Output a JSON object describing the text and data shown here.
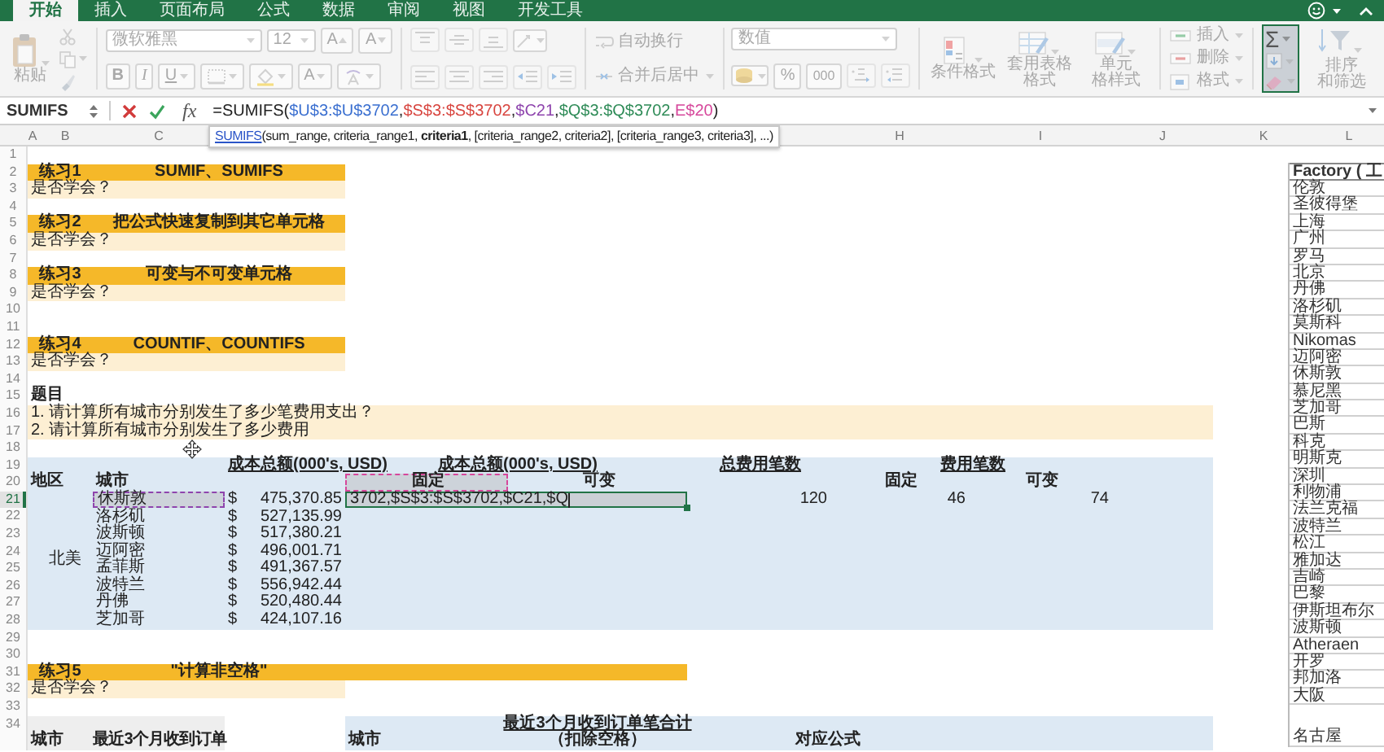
{
  "tabs": [
    {
      "label": "开始",
      "selected": true
    },
    {
      "label": "插入",
      "selected": false
    },
    {
      "label": "页面布局",
      "selected": false
    },
    {
      "label": "公式",
      "selected": false
    },
    {
      "label": "数据",
      "selected": false
    },
    {
      "label": "审阅",
      "selected": false
    },
    {
      "label": "视图",
      "selected": false
    },
    {
      "label": "开发工具",
      "selected": false
    }
  ],
  "ribbon": {
    "disabled": true,
    "paste_label": "粘贴",
    "font_name": "微软雅黑",
    "font_size": "12",
    "grow_label": "A",
    "shrink_label": "A",
    "bold_label": "B",
    "italic_label": "I",
    "underline_label": "U",
    "font_color_label": "A",
    "wrap_label": "自动换行",
    "merge_label": "合并后居中",
    "number_format": "数值",
    "percent_label": "%",
    "thousands_label": "000",
    "style_buttons": [
      {
        "kind": "conditional",
        "lines": [
          "条件格式"
        ]
      },
      {
        "kind": "table",
        "lines": [
          "套用表格",
          "格式"
        ]
      },
      {
        "kind": "cell",
        "lines": [
          "单元",
          "格样式"
        ]
      }
    ],
    "cell_buttons": [
      {
        "kind": "insert",
        "label": "插入"
      },
      {
        "kind": "delete",
        "label": "删除"
      },
      {
        "kind": "format",
        "label": "格式"
      }
    ],
    "sum_label": "Σ",
    "sort_lines": [
      "排序",
      "和筛选"
    ]
  },
  "formula_bar": {
    "name_box": "SUMIFS",
    "fx": "fx",
    "segments": [
      {
        "text": "=SUMIFS("
      },
      {
        "text": "$U$3:$U$3702",
        "color": "#3a6fd0"
      },
      {
        "text": ","
      },
      {
        "text": "$S$3:$S$3702",
        "color": "#d8453f"
      },
      {
        "text": ","
      },
      {
        "text": "$C21",
        "color": "#8e44ad"
      },
      {
        "text": ","
      },
      {
        "text": "$Q$3:$Q$3702",
        "color": "#2e8b57"
      },
      {
        "text": ","
      },
      {
        "text": "E$20",
        "color": "#d6479b"
      },
      {
        "text": ")"
      }
    ]
  },
  "tooltip": {
    "function_link": "SUMIFS",
    "signature": "(sum_range, criteria_range1, **criteria1**, [criteria_range2, criteria2], [criteria_range3, criteria3], ...)"
  },
  "sheet": {
    "columns": [
      "A",
      "B",
      "C",
      "H",
      "I",
      "J",
      "K",
      "L"
    ],
    "rows": [
      {
        "label": "1",
        "selected": false
      },
      {
        "label": "2",
        "selected": false
      },
      {
        "label": "3",
        "selected": false
      },
      {
        "label": "4",
        "selected": false
      },
      {
        "label": "5",
        "selected": false
      },
      {
        "label": "6",
        "selected": false
      },
      {
        "label": "7",
        "selected": false
      },
      {
        "label": "8",
        "selected": false
      },
      {
        "label": "9",
        "selected": false
      },
      {
        "label": "10",
        "selected": false
      },
      {
        "label": "11",
        "selected": false
      },
      {
        "label": "12",
        "selected": false
      },
      {
        "label": "13",
        "selected": false
      },
      {
        "label": "14",
        "selected": false
      },
      {
        "label": "15",
        "selected": false
      },
      {
        "label": "16",
        "selected": false
      },
      {
        "label": "17",
        "selected": false
      },
      {
        "label": "18",
        "selected": false
      },
      {
        "label": "19",
        "selected": false
      },
      {
        "label": "20",
        "selected": false
      },
      {
        "label": "21",
        "selected": true
      },
      {
        "label": "22",
        "selected": false
      },
      {
        "label": "23",
        "selected": false
      },
      {
        "label": "24",
        "selected": false
      },
      {
        "label": "25",
        "selected": false
      },
      {
        "label": "26",
        "selected": false
      },
      {
        "label": "27",
        "selected": false
      },
      {
        "label": "28",
        "selected": false
      },
      {
        "label": "29",
        "selected": false
      },
      {
        "label": "30",
        "selected": false
      },
      {
        "label": "31",
        "selected": false
      },
      {
        "label": "32",
        "selected": false
      },
      {
        "label": "33",
        "selected": false
      },
      {
        "label": "34",
        "selected": false
      }
    ],
    "exercises": [
      {
        "number": "练习1",
        "topic": "SUMIF、SUMIFS",
        "question": "是否学会？"
      },
      {
        "number": "练习2",
        "topic": "把公式快速复制到其它单元格",
        "question": "是否学会？"
      },
      {
        "number": "练习3",
        "topic": "可变与不可变单元格",
        "question": "是否学会？"
      },
      {
        "number": "练习4",
        "topic": "COUNTIF、COUNTIFS",
        "question": "是否学会？"
      },
      {
        "number": "练习5",
        "topic": "\"计算非空格\"",
        "question": "是否学会？"
      }
    ],
    "task": {
      "title": "题目",
      "items": [
        "1. 请计算所有城市分别发生了多少笔费用支出？",
        "2. 请计算所有城市分别发生了多少费用"
      ]
    },
    "cost_table": {
      "cost_header": "成本总额(000's, USD)",
      "split_cost_header": "成本总额(000's, USD)",
      "total_count_header": "总费用笔数",
      "count_header": "费用笔数",
      "region_header": "地区",
      "city_header": "城市",
      "fixed_header": {
        "text": "固定",
        "color": "#d6479b"
      },
      "variable_header": "可变",
      "count_fixed_header": "固定",
      "count_variable_header": "可变",
      "region": "北美",
      "rows": [
        {
          "city": "休斯敦",
          "color": "#8e44ad",
          "currency": "$",
          "amount": "475,370.85"
        },
        {
          "city": "洛杉矶",
          "currency": "$",
          "amount": "527,135.99"
        },
        {
          "city": "波斯顿",
          "currency": "$",
          "amount": "517,380.21"
        },
        {
          "city": "迈阿密",
          "currency": "$",
          "amount": "496,001.71"
        },
        {
          "city": "孟菲斯",
          "currency": "$",
          "amount": "491,367.57"
        },
        {
          "city": "波特兰",
          "currency": "$",
          "amount": "556,942.44"
        },
        {
          "city": "丹佛",
          "currency": "$",
          "amount": "520,480.44"
        },
        {
          "city": "芝加哥",
          "currency": "$",
          "amount": "424,107.16"
        }
      ],
      "editor_text": "3702,$S$3:$S$3702,$C21,$Q",
      "total_count": "120",
      "fixed_count": "46",
      "variable_count": "74"
    },
    "orders_table": {
      "city_header": "城市",
      "orders_header": "最近3个月收到订单",
      "summary_city_header": "城市",
      "total_header": "最近3个月收到订单笔合计",
      "total_note": "（扣除空格）",
      "formula_header": "对应公式"
    }
  },
  "factory_list": {
    "header": "Factory ( 工",
    "items": [
      "伦敦",
      "圣彼得堡",
      "上海",
      "广州",
      "罗马",
      "北京",
      "丹佛",
      "洛杉矶",
      "莫斯科",
      "Nikomas",
      "迈阿密",
      "休斯敦",
      "慕尼黑",
      "芝加哥",
      "巴斯",
      "科克",
      "明斯克",
      "深圳",
      "利物浦",
      "法兰克福",
      "波特兰",
      "松江",
      "雅加达",
      "吉崎",
      "巴黎",
      "伊斯坦布尔",
      "波斯顿",
      "Atheraen",
      "开罗",
      "邦加洛",
      "大阪"
    ],
    "tail_item": "名古屋"
  }
}
